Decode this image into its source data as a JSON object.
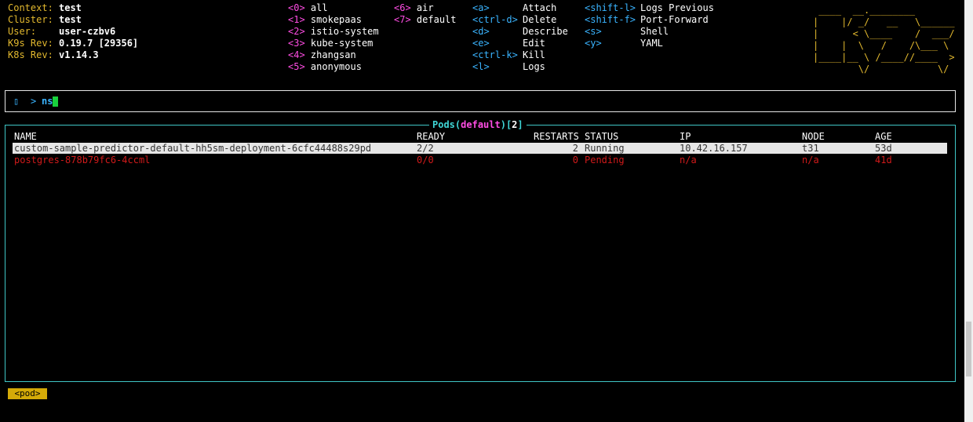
{
  "info": [
    {
      "label": "Context:",
      "value": "test"
    },
    {
      "label": "Cluster:",
      "value": "test"
    },
    {
      "label": "User:",
      "value": "user-czbv6"
    },
    {
      "label": "K9s Rev:",
      "value": "0.19.7 [29356]"
    },
    {
      "label": "K8s Rev:",
      "value": "v1.14.3"
    }
  ],
  "namespaces": [
    {
      "key": "<0>",
      "name": "all"
    },
    {
      "key": "<1>",
      "name": "smokepaas"
    },
    {
      "key": "<2>",
      "name": "istio-system"
    },
    {
      "key": "<3>",
      "name": "kube-system"
    },
    {
      "key": "<4>",
      "name": "zhangsan"
    },
    {
      "key": "<5>",
      "name": "anonymous"
    },
    {
      "key": "<6>",
      "name": "air"
    },
    {
      "key": "<7>",
      "name": "default"
    }
  ],
  "hotkeys": [
    {
      "key": "<a>",
      "action": "Attach"
    },
    {
      "key": "<ctrl-d>",
      "action": "Delete"
    },
    {
      "key": "<d>",
      "action": "Describe"
    },
    {
      "key": "<e>",
      "action": "Edit"
    },
    {
      "key": "<ctrl-k>",
      "action": "Kill"
    },
    {
      "key": "<l>",
      "action": "Logs"
    },
    {
      "key": "<shift-l>",
      "action": "Logs Previous"
    },
    {
      "key": "<shift-f>",
      "action": "Port-Forward"
    },
    {
      "key": "<s>",
      "action": "Shell"
    },
    {
      "key": "<y>",
      "action": "YAML"
    }
  ],
  "logo": [
    " ____  __.________       ",
    "|    |/ _/   __   \\______",
    "|      < \\____    /  ___/",
    "|    |  \\   /    /\\___ \\ ",
    "|____|__ \\ /____//____  >",
    "        \\/            \\/ "
  ],
  "prompt": {
    "icon": "▯",
    "arrow": ">",
    "text": "ns"
  },
  "table": {
    "title": "Pods",
    "namespace": "default",
    "count": "2",
    "columns": [
      "NAME",
      "READY",
      "RESTARTS",
      "STATUS",
      "IP",
      "NODE",
      "AGE"
    ],
    "rows": [
      {
        "name": "custom-sample-predictor-default-hh5sm-deployment-6cfc44488s29pd",
        "ready": "2/2",
        "restarts": "2",
        "status": "Running",
        "ip": "10.42.16.157",
        "node": "t31",
        "age": "53d"
      },
      {
        "name": "postgres-878b79fc6-4ccml",
        "ready": "0/0",
        "restarts": "0",
        "status": "Pending",
        "ip": "n/a",
        "node": "n/a",
        "age": "41d"
      }
    ]
  },
  "breadcrumb": "<pod>",
  "colors": {
    "accent": "#e2b82e",
    "namespace_key": "#ff4de4",
    "hotkey": "#3ab4ff",
    "border": "#3fc7c7",
    "error": "#d01a1a"
  }
}
